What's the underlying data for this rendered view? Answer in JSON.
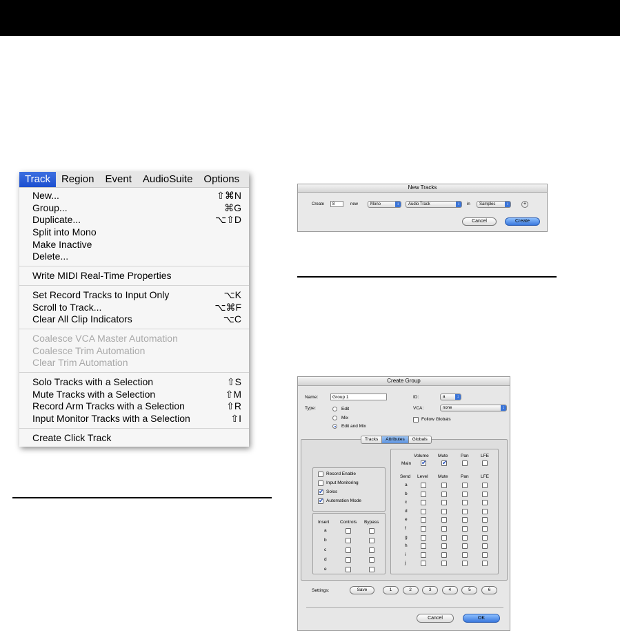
{
  "track_menu": {
    "menubar": [
      "Track",
      "Region",
      "Event",
      "AudioSuite",
      "Options"
    ],
    "groups": [
      [
        {
          "label": "New...",
          "shortcut": "⇧⌘N",
          "enabled": true
        },
        {
          "label": "Group...",
          "shortcut": "⌘G",
          "enabled": true
        },
        {
          "label": "Duplicate...",
          "shortcut": "⌥⇧D",
          "enabled": true
        },
        {
          "label": "Split into Mono",
          "shortcut": "",
          "enabled": true
        },
        {
          "label": "Make Inactive",
          "shortcut": "",
          "enabled": true
        },
        {
          "label": "Delete...",
          "shortcut": "",
          "enabled": true
        }
      ],
      [
        {
          "label": "Write MIDI Real-Time Properties",
          "shortcut": "",
          "enabled": true
        }
      ],
      [
        {
          "label": "Set Record Tracks to Input Only",
          "shortcut": "⌥K",
          "enabled": true
        },
        {
          "label": "Scroll to Track...",
          "shortcut": "⌥⌘F",
          "enabled": true
        },
        {
          "label": "Clear All Clip Indicators",
          "shortcut": "⌥C",
          "enabled": true
        }
      ],
      [
        {
          "label": "Coalesce VCA Master Automation",
          "shortcut": "",
          "enabled": false
        },
        {
          "label": "Coalesce Trim Automation",
          "shortcut": "",
          "enabled": false
        },
        {
          "label": "Clear Trim Automation",
          "shortcut": "",
          "enabled": false
        }
      ],
      [
        {
          "label": "Solo Tracks with a Selection",
          "shortcut": "⇧S",
          "enabled": true
        },
        {
          "label": "Mute Tracks with a Selection",
          "shortcut": "⇧M",
          "enabled": true
        },
        {
          "label": "Record Arm Tracks with a Selection",
          "shortcut": "⇧R",
          "enabled": true
        },
        {
          "label": "Input Monitor Tracks with a Selection",
          "shortcut": "⇧I",
          "enabled": true
        }
      ],
      [
        {
          "label": "Create Click Track",
          "shortcut": "",
          "enabled": true
        }
      ]
    ]
  },
  "new_tracks": {
    "title": "New Tracks",
    "create_label": "Create",
    "count": "8",
    "new_label": "new",
    "format": "Mono",
    "track_type": "Audio Track",
    "in_label": "in",
    "timebase": "Samples",
    "add_symbol": "+",
    "cancel": "Cancel",
    "create_button": "Create"
  },
  "create_group": {
    "title": "Create Group",
    "name_label": "Name:",
    "name_value": "Group 1",
    "id_label": "ID:",
    "id_value": "a",
    "type_label": "Type:",
    "types": [
      "Edit",
      "Mix",
      "Edit and Mix"
    ],
    "selected_type": "Edit and Mix",
    "vca_label": "VCA:",
    "vca_value": "none",
    "follow_globals": "Follow Globals",
    "tabs": [
      "Tracks",
      "Attributes",
      "Globals"
    ],
    "active_tab": "Attributes",
    "options": [
      {
        "label": "Record Enable",
        "checked": false
      },
      {
        "label": "Input Monitoring",
        "checked": false
      },
      {
        "label": "Solos",
        "checked": true
      },
      {
        "label": "Automation Mode",
        "checked": true
      }
    ],
    "main_header": [
      "Volume",
      "Mute",
      "Pan",
      "LFE"
    ],
    "main_label": "Main",
    "main_checked": [
      true,
      true,
      false,
      false
    ],
    "send_header": [
      "Send",
      "Level",
      "Mute",
      "Pan",
      "LFE"
    ],
    "sends": [
      "a",
      "b",
      "c",
      "d",
      "e",
      "f",
      "g",
      "h",
      "i",
      "j"
    ],
    "insert_header": [
      "Insert",
      "Controls",
      "Bypass"
    ],
    "inserts": [
      "a",
      "b",
      "c",
      "d",
      "e"
    ],
    "settings_label": "Settings:",
    "save": "Save",
    "presets": [
      "1",
      "2",
      "3",
      "4",
      "5",
      "6"
    ],
    "cancel": "Cancel",
    "ok": "OK"
  }
}
